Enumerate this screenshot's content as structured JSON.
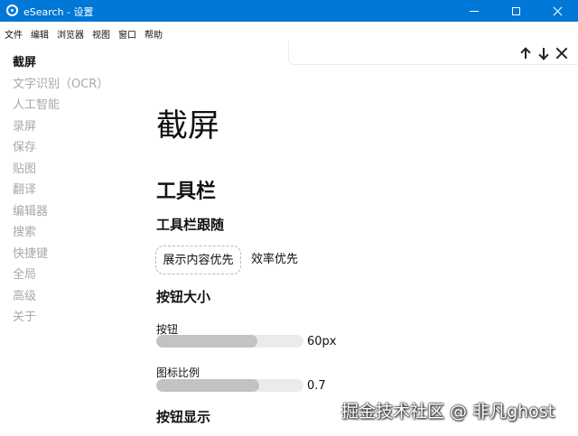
{
  "window": {
    "title": "eSearch - 设置"
  },
  "menu": [
    "文件",
    "编辑",
    "浏览器",
    "视图",
    "窗口",
    "帮助"
  ],
  "findbar": {
    "up": "up-arrow",
    "down": "down-arrow",
    "close": "close"
  },
  "sidebar": {
    "items": [
      "截屏",
      "文字识别（OCR）",
      "人工智能",
      "录屏",
      "保存",
      "贴图",
      "翻译",
      "编辑器",
      "搜索",
      "快捷键",
      "全局",
      "高级",
      "关于"
    ],
    "active_index": 0
  },
  "main": {
    "page_title": "截屏",
    "section_toolbar": "工具栏",
    "toolbar_follow": {
      "heading": "工具栏跟随",
      "options": [
        "展示内容优先",
        "效率优先"
      ],
      "selected": "展示内容优先"
    },
    "button_size": {
      "heading": "按钮大小",
      "button_label": "按钮",
      "button_value": "60px",
      "button_fraction": 0.69,
      "ratio_label": "图标比例",
      "ratio_value": "0.7",
      "ratio_fraction": 0.7
    },
    "button_display": {
      "heading": "按钮显示"
    }
  },
  "watermark": "掘金技术社区 @ 非凡ghost",
  "colors": {
    "titlebar": "#0078d7",
    "slider_fill": "#c3c3c3",
    "slider_track": "#ebebeb"
  }
}
